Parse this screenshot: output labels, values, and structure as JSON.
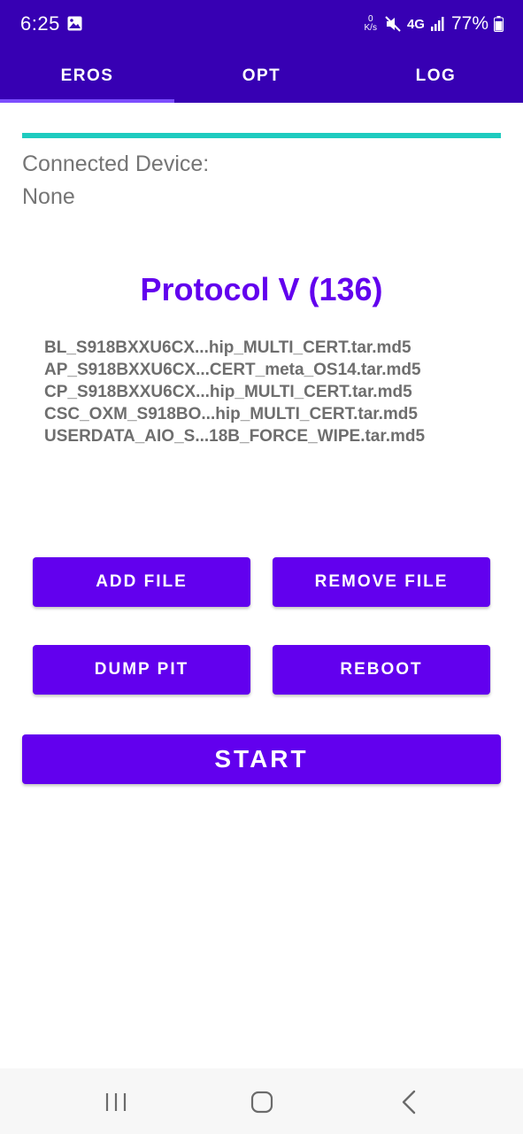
{
  "status_bar": {
    "time": "6:25",
    "net_speed_value": "0",
    "net_speed_unit": "K/s",
    "network": "4G",
    "battery": "77%"
  },
  "tabs": [
    {
      "label": "EROS",
      "selected": true
    },
    {
      "label": "OPT",
      "selected": false
    },
    {
      "label": "LOG",
      "selected": false
    }
  ],
  "progress": 1.0,
  "device": {
    "label": "Connected Device:",
    "value": "None"
  },
  "protocol": "Protocol V (136)",
  "files": [
    "BL_S918BXXU6CX...hip_MULTI_CERT.tar.md5",
    "AP_S918BXXU6CX...CERT_meta_OS14.tar.md5",
    "CP_S918BXXU6CX...hip_MULTI_CERT.tar.md5",
    "CSC_OXM_S918BO...hip_MULTI_CERT.tar.md5",
    "USERDATA_AIO_S...18B_FORCE_WIPE.tar.md5"
  ],
  "buttons": {
    "add_file": "ADD FILE",
    "remove_file": "REMOVE FILE",
    "dump_pit": "DUMP PIT",
    "reboot": "REBOOT",
    "start": "START"
  },
  "colors": {
    "header": "#3700b3",
    "primary": "#6200ee",
    "progress": "#1ecbbf",
    "indicator": "#7c4dff"
  },
  "icons": {
    "gallery": "image-icon",
    "mute": "mute-icon",
    "signal": "signal-icon",
    "battery": "battery-icon",
    "recents": "recents-icon",
    "home": "home-icon",
    "back": "back-icon"
  }
}
